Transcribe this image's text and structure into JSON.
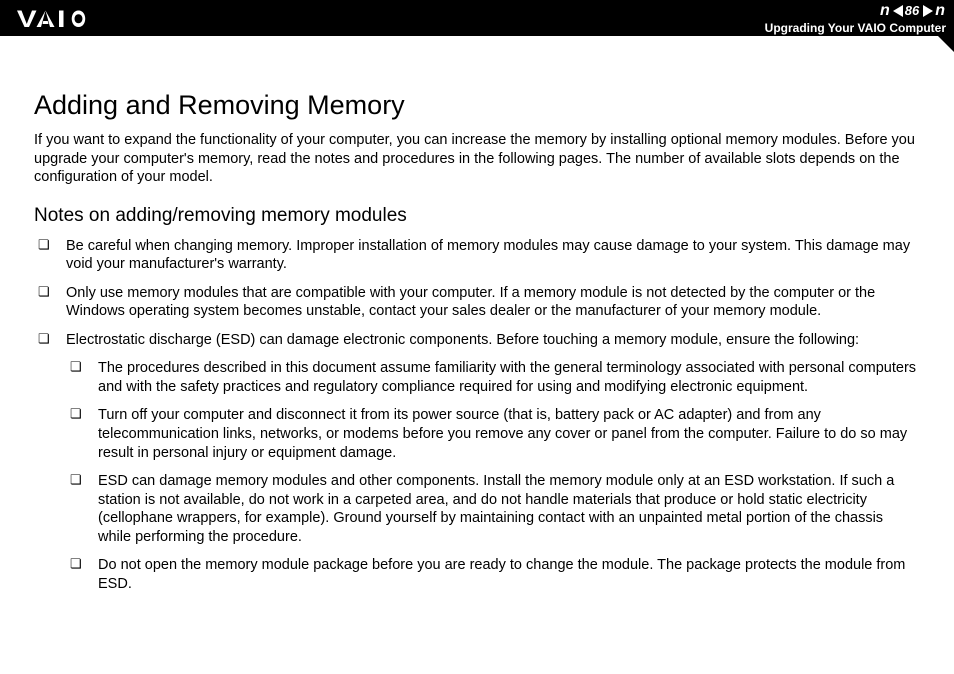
{
  "header": {
    "page_number": "86",
    "n_text": "n",
    "section": "Upgrading Your VAIO Computer"
  },
  "title": "Adding and Removing Memory",
  "intro": "If you want to expand the functionality of your computer, you can increase the memory by installing optional memory modules. Before you upgrade your computer's memory, read the notes and procedures in the following pages. The number of available slots depends on the configuration of your model.",
  "subtitle": "Notes on adding/removing memory modules",
  "bullets": [
    "Be careful when changing memory. Improper installation of memory modules may cause damage to your system. This damage may void your manufacturer's warranty.",
    "Only use memory modules that are compatible with your computer. If a memory module is not detected by the computer or the Windows operating system becomes unstable, contact your sales dealer or the manufacturer of your memory module.",
    "Electrostatic discharge (ESD) can damage electronic components. Before touching a memory module, ensure the following:"
  ],
  "sub_bullets": [
    "The procedures described in this document assume familiarity with the general terminology associated with personal computers and with the safety practices and regulatory compliance required for using and modifying electronic equipment.",
    "Turn off your computer and disconnect it from its power source (that is, battery pack or AC adapter) and from any telecommunication links, networks, or modems before you remove any cover or panel from the computer. Failure to do so may result in personal injury or equipment damage.",
    "ESD can damage memory modules and other components. Install the memory module only at an ESD workstation. If such a station is not available, do not work in a carpeted area, and do not handle materials that produce or hold static electricity (cellophane wrappers, for example). Ground yourself by maintaining contact with an unpainted metal portion of the chassis while performing the procedure.",
    "Do not open the memory module package before you are ready to change the module. The package protects the module from ESD."
  ]
}
